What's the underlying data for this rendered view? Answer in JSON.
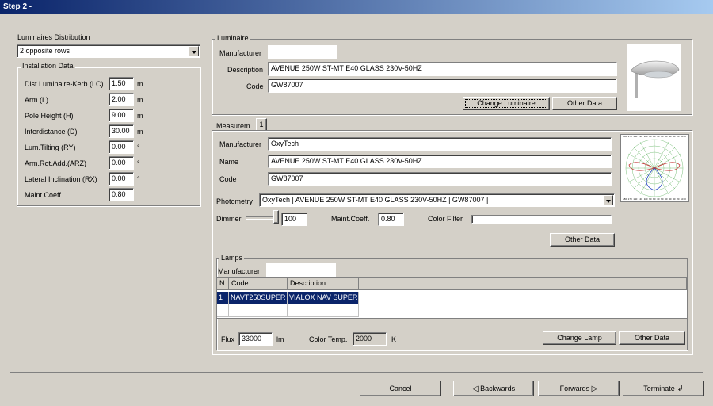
{
  "window": {
    "title": "Step 2 -"
  },
  "left": {
    "distribution_label": "Luminaires Distribution",
    "distribution_value": "2 opposite rows",
    "installation_title": "Installation Data",
    "fields": [
      {
        "label": "Dist.Luminaire-Kerb (LC)",
        "value": "1.50",
        "unit": "m"
      },
      {
        "label": "Arm (L)",
        "value": "2.00",
        "unit": "m"
      },
      {
        "label": "Pole Height (H)",
        "value": "9.00",
        "unit": "m"
      },
      {
        "label": "Interdistance (D)",
        "value": "30.00",
        "unit": "m"
      },
      {
        "label": "Lum.Tilting (RY)",
        "value": "0.00",
        "unit": "°"
      },
      {
        "label": "Arm.Rot.Add.(ARZ)",
        "value": "0.00",
        "unit": "°"
      },
      {
        "label": "Lateral Inclination (RX)",
        "value": "0.00",
        "unit": "°"
      },
      {
        "label": "Maint.Coeff.",
        "value": "0.80",
        "unit": ""
      }
    ]
  },
  "luminaire": {
    "title": "Luminaire",
    "manufacturer_label": "Manufacturer",
    "manufacturer_value": "",
    "description_label": "Description",
    "description_value": "AVENUE 250W ST-MT E40 GLASS 230V-50HZ",
    "code_label": "Code",
    "code_value": "GW87007",
    "change_button": "Change Luminaire",
    "other_button": "Other Data"
  },
  "measurement": {
    "tab_label": "Measurem.",
    "tab_number": "1",
    "manufacturer_label": "Manufacturer",
    "manufacturer_value": "OxyTech",
    "name_label": "Name",
    "name_value": "AVENUE 250W ST-MT E40 GLASS 230V-50HZ",
    "code_label": "Code",
    "code_value": "GW87007",
    "photometry_label": "Photometry",
    "photometry_value": "OxyTech | AVENUE 250W ST-MT E40 GLASS 230V-50HZ | GW87007 |",
    "dimmer_label": "Dimmer",
    "dimmer_value": "100",
    "dimmer_level": 1.0,
    "maint_label": "Maint.Coeff.",
    "maint_value": "0.80",
    "color_filter_label": "Color Filter",
    "other_button": "Other Data"
  },
  "lamps": {
    "title": "Lamps",
    "manufacturer_label": "Manufacturer",
    "manufacturer_value": "",
    "columns": [
      "N",
      "Code",
      "Description"
    ],
    "rows": [
      {
        "n": "1",
        "code": "NAVT250SUPER",
        "description": "VIALOX NAV SUPER"
      }
    ],
    "flux_label": "Flux",
    "flux_value": "33000",
    "flux_unit": "lm",
    "color_temp_label": "Color Temp.",
    "color_temp_value": "2000",
    "color_temp_unit": "K",
    "change_button": "Change Lamp",
    "other_button": "Other Data"
  },
  "footer": {
    "cancel": "Cancel",
    "backwards": "Backwards",
    "forwards": "Forwards",
    "terminate": "Terminate"
  },
  "polar_ticks": [
    "180",
    "170",
    "150",
    "130",
    "110",
    "90",
    "80",
    "70",
    "60",
    "50",
    "40",
    "30",
    "20",
    "10",
    "0"
  ]
}
